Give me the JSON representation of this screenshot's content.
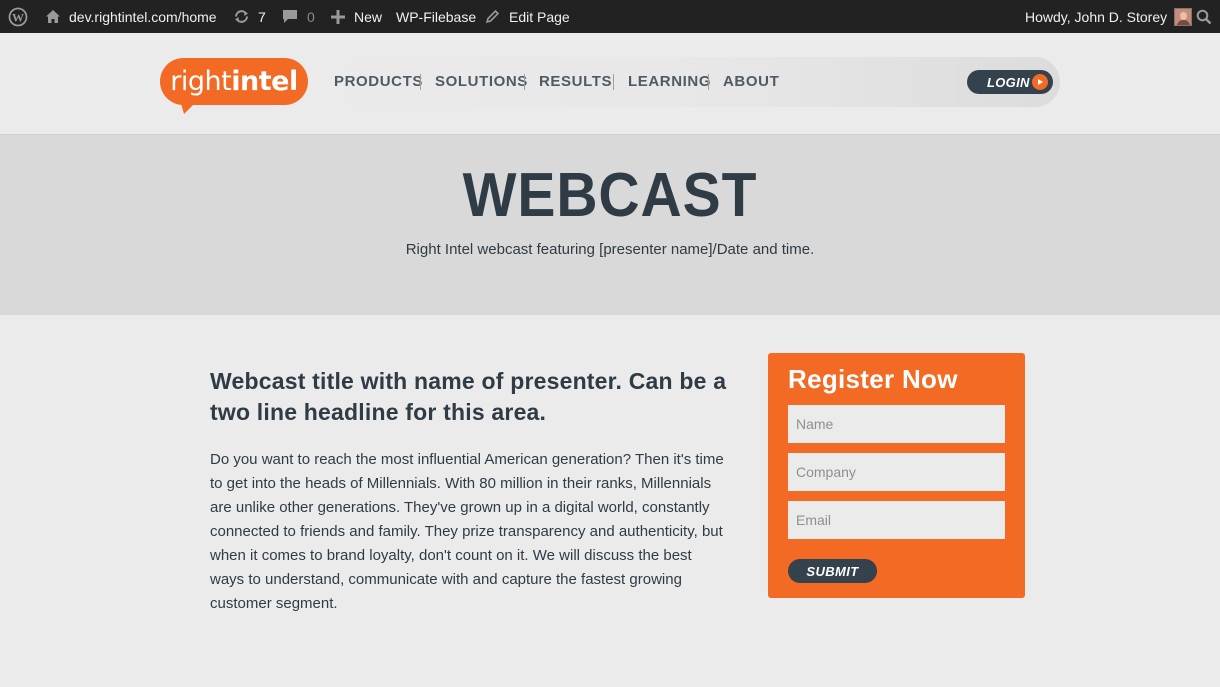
{
  "adminbar": {
    "site_url": "dev.rightintel.com/home",
    "updates_count": "7",
    "comments_count": "0",
    "new_label": "New",
    "filebase_label": "WP-Filebase",
    "edit_label": "Edit Page",
    "howdy": "Howdy, John D. Storey"
  },
  "header": {
    "logo_light": "right",
    "logo_bold": "intel",
    "nav": [
      "PRODUCTS",
      "SOLUTIONS",
      "RESULTS",
      "LEARNING",
      "ABOUT"
    ],
    "login_label": "LOGIN"
  },
  "hero": {
    "title": "WEBCAST",
    "subtitle": "Right Intel webcast featuring [presenter name]/Date and time."
  },
  "article": {
    "title": "Webcast title with name of presenter. Can be a two line headline for this area.",
    "body": "Do you want to reach the most influential American generation? Then it's time to get into the heads of Millennials. With 80 million in their ranks, Millennials are unlike other generations. They've grown up in a digital world, constantly connected to friends and family. They prize transparency and authenticity, but when it comes to brand loyalty, don't count on it. We will discuss the best ways to understand, communicate with and capture the fastest growing customer segment."
  },
  "register": {
    "title": "Register Now",
    "name_placeholder": "Name",
    "company_placeholder": "Company",
    "email_placeholder": "Email",
    "submit_label": "SUBMIT"
  },
  "colors": {
    "brand_orange": "#f26a24",
    "dark_slate": "#34424d",
    "adminbar_bg": "#222222"
  }
}
